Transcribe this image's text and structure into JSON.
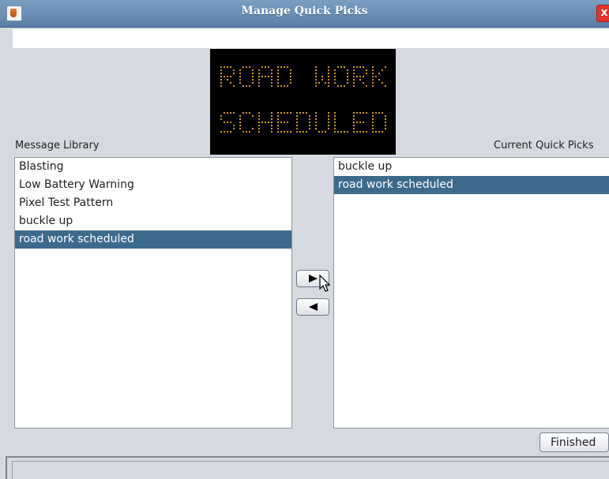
{
  "window": {
    "title": "Manage Quick Picks",
    "close_label": "x"
  },
  "sign": {
    "lines": [
      "ROAD WORK",
      "SCHEDULED"
    ],
    "color": "#e0a820",
    "background": "#000000"
  },
  "library": {
    "label": "Message Library",
    "items": [
      {
        "label": "Blasting",
        "selected": false
      },
      {
        "label": "Low Battery Warning",
        "selected": false
      },
      {
        "label": "Pixel Test Pattern",
        "selected": false
      },
      {
        "label": "buckle up",
        "selected": false
      },
      {
        "label": "road work scheduled",
        "selected": true
      }
    ]
  },
  "quick_picks": {
    "label": "Current Quick Picks",
    "items": [
      {
        "label": "buckle up",
        "selected": false
      },
      {
        "label": "road work scheduled",
        "selected": true
      }
    ]
  },
  "buttons": {
    "add_icon": "arrow-right-icon",
    "remove_icon": "arrow-left-icon",
    "finished_label": "Finished"
  },
  "colors": {
    "selection": "#3c6a8d",
    "titlebar": "#6a8fb6",
    "background": "#d6d9df"
  }
}
